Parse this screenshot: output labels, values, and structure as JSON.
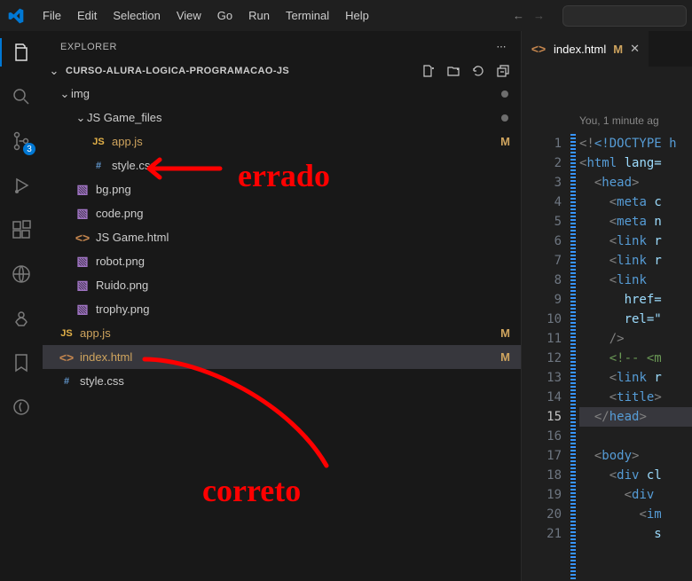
{
  "menu": {
    "file": "File",
    "edit": "Edit",
    "selection": "Selection",
    "view": "View",
    "go": "Go",
    "run": "Run",
    "terminal": "Terminal",
    "help": "Help"
  },
  "activity_badge": "3",
  "explorer": {
    "title": "EXPLORER",
    "project": "CURSO-ALURA-LOGICA-PROGRAMACAO-JS",
    "folders": {
      "img": "img",
      "jsg": "JS Game_files"
    },
    "files": {
      "appjs1": "app.js",
      "stylecss1": "style.css",
      "bg": "bg.png",
      "code": "code.png",
      "jsgame": "JS Game.html",
      "robot": "robot.png",
      "ruido": "Ruido.png",
      "trophy": "trophy.png",
      "appjs2": "app.js",
      "index": "index.html",
      "stylecss2": "style.css"
    },
    "status": {
      "M": "M"
    }
  },
  "tab": {
    "file": "index.html",
    "m": "M"
  },
  "code": {
    "author": "You, 1 minute ag",
    "l1": "<!DOCTYPE h",
    "l2a": "<",
    "l2b": "html ",
    "l2c": "lang=",
    "l3": "<head>",
    "l4": "<meta c",
    "l5": "<meta n",
    "l6": "<link r",
    "l7": "<link r",
    "l8": "<link",
    "l9": "href=",
    "l10": "rel=\"",
    "l11": "/>",
    "l12": "<!-- <m",
    "l13": "<link r",
    "l14": "<title>",
    "l15": "</head>",
    "l17": "<body>",
    "l18": "<div cl",
    "l19": "<div",
    "l20": "<im",
    "l21": "s"
  },
  "annotations": {
    "errado": "errado",
    "correto": "correto"
  }
}
